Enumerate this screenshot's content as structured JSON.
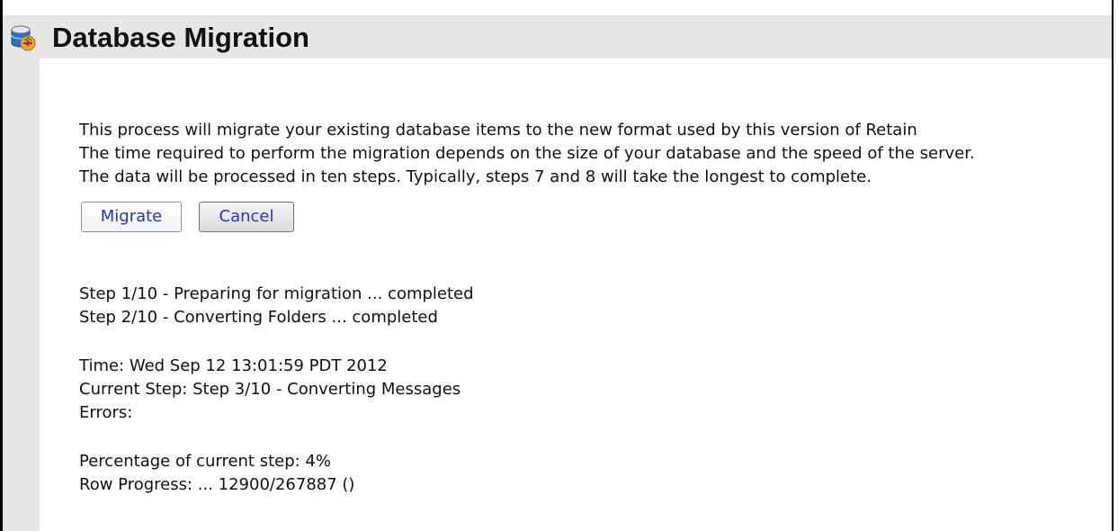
{
  "header": {
    "title": "Database Migration",
    "icon": "database-migration-icon"
  },
  "intro": {
    "line1": "This process will migrate your existing database items to the new format used by this version of Retain",
    "line2": "The time required to perform the migration depends on the size of your database and the speed of the server.",
    "line3": "The data will be processed in ten steps. Typically, steps 7 and 8 will take the longest to complete."
  },
  "buttons": {
    "migrate": "Migrate",
    "cancel": "Cancel"
  },
  "steps": {
    "step1": "Step 1/10 - Preparing for migration ... completed",
    "step2": "Step 2/10 - Converting Folders ... completed"
  },
  "status": {
    "time": "Time: Wed Sep 12 13:01:59 PDT 2012",
    "current_step": "Current Step: Step 3/10 - Converting Messages",
    "errors": "Errors:"
  },
  "progress": {
    "percentage": "Percentage of current step: 4%",
    "rows": "Row Progress: ... 12900/267887 ()"
  },
  "colors": {
    "header_bg": "#e6e6e6",
    "button_text": "#2a35c4"
  }
}
